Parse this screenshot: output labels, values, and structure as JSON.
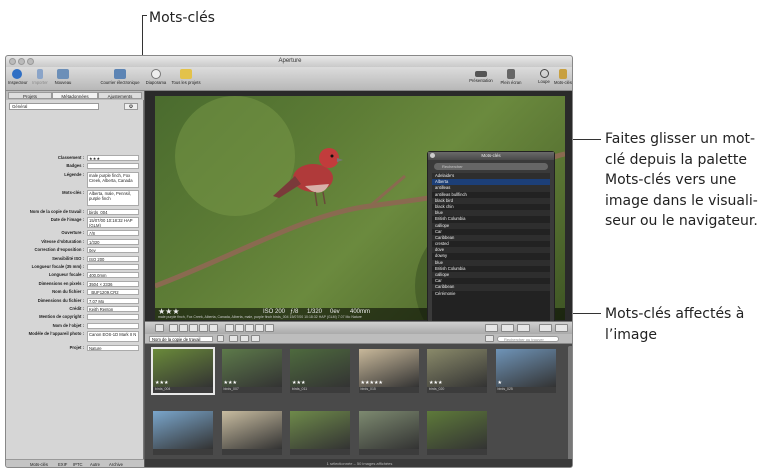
{
  "callouts": {
    "top": "Mots-clés",
    "right1": [
      "Faites glisser un mot-",
      "clé depuis la palette",
      "Mots-clés vers une",
      "image dans le visuali-",
      "seur ou le navigateur."
    ],
    "right2": [
      "Mots-clés affectés à",
      "l’image"
    ]
  },
  "window": {
    "title": "Aperture",
    "toolbar": {
      "inspector": "Inspecteur",
      "import": "Importer",
      "new": "Nouveau",
      "email": "Courrier électronique",
      "slideshow": "Diaporama",
      "all_projects": "Tous les projets",
      "presentation": "Présentation",
      "fullscreen": "Plein écran",
      "loupe": "Loupe",
      "keywords": "Mots-clés"
    },
    "left_panel": {
      "tabs": [
        "Projets",
        "Métadonnées",
        "Ajustements"
      ],
      "selected_tab": "Métadonnées",
      "view_select": "Général",
      "fields": [
        {
          "label": "Classement :",
          "value": "★★★"
        },
        {
          "label": "Badges :",
          "value": ""
        },
        {
          "label": "Légende :",
          "value": "male purple finch, Fox Creek, Alberta, Canada"
        },
        {
          "label": "Mots-clés :",
          "value": "Alberta, male, Pennsil, purple finch"
        },
        {
          "label": "Nom de la copie de travail :",
          "value": "birds_004"
        },
        {
          "label": "Date de l’image :",
          "value": "15/07/00 10:18:32 HAP (GLM)"
        },
        {
          "label": "Ouverture :",
          "value": "ƒ/8"
        },
        {
          "label": "Vitesse d’obturation :",
          "value": "1/320"
        },
        {
          "label": "Correction d’exposition :",
          "value": "0ev"
        },
        {
          "label": "Sensibilité ISO :",
          "value": "ISO 200"
        },
        {
          "label": "Longueur focale (35 mm) :",
          "value": ""
        },
        {
          "label": "Longueur focale :",
          "value": "400.0mm"
        },
        {
          "label": "Dimensions en pixels :",
          "value": "3504 × 2336"
        },
        {
          "label": "Nom du fichier :",
          "value": "_BUF1209.CR2"
        },
        {
          "label": "Dimensions du fichier :",
          "value": "7.07 Mo"
        },
        {
          "label": "Crédit :",
          "value": "Keith Renton"
        },
        {
          "label": "Mention de copyright :",
          "value": ""
        },
        {
          "label": "Nom de l’objet :",
          "value": ""
        },
        {
          "label": "Modèle de l’appareil photo :",
          "value": "Canon EOS-1D Mark II N"
        },
        {
          "label": "Projet :",
          "value": "Nature"
        }
      ],
      "bottom_tabs": [
        "Mots-clés",
        "EXIF",
        "IPTC",
        "Autre",
        "Archive"
      ]
    },
    "viewer": {
      "rating": "★★★",
      "iso": "ISO 200",
      "aperture": "ƒ/8",
      "shutter": "1/320",
      "exposure": "0ev",
      "focal": "400mm",
      "caption": "male purple finch, Fox Creek, Alberta, Canada, Alberta, male, purple finch   birds_004   15/07/00 10:18:32 HAP (GLM)   7.07 Mo   Nature"
    },
    "keyword_palette": {
      "title": "Mots-clés",
      "search_placeholder": "Rechercher",
      "items": [
        "Adelaide's",
        "Alberta",
        "antilleas",
        "antilleas bullfinch",
        "black bird",
        "black chin",
        "blue",
        "British Columbia",
        "calliope",
        "Car",
        "Caribbean",
        "crested",
        "dove",
        "downy",
        "blue",
        "British Columbia",
        "calliope",
        "Car",
        "Caribbean",
        "Cérémonie"
      ],
      "selected_index": 1,
      "import_button": "Importer...",
      "export_button": "Exporter..."
    },
    "browser": {
      "sort_select": "Nom de la copie de travail",
      "search_placeholder": "Rechercher ou trouver",
      "thumbnails": [
        {
          "name": "birds_004",
          "stars": "★★★",
          "color": "#6a8a3a"
        },
        {
          "name": "birds_007",
          "stars": "★★★",
          "color": "#5d7a4a"
        },
        {
          "name": "birds_011",
          "stars": "★★★",
          "color": "#4e6a3e"
        },
        {
          "name": "birds_015",
          "stars": "★★★★★",
          "color": "#c8b89a"
        },
        {
          "name": "birds_020",
          "stars": "★★★",
          "color": "#8a8a6a"
        },
        {
          "name": "birds_025",
          "stars": "★",
          "color": "#6f94b8"
        },
        {
          "name": "",
          "stars": "",
          "color": "#7aa6cc"
        },
        {
          "name": "",
          "stars": "",
          "color": "#c8bca0"
        },
        {
          "name": "",
          "stars": "",
          "color": "#6e8a4a"
        },
        {
          "name": "",
          "stars": "",
          "color": "#7d8a70"
        },
        {
          "name": "",
          "stars": "",
          "color": "#5e7a3a"
        }
      ],
      "status": "1 sélectionnée – 50 images affichées"
    }
  }
}
